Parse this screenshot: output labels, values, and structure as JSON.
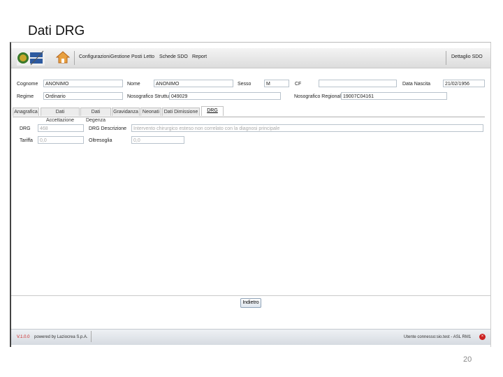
{
  "slide": {
    "title": "Dati DRG",
    "page_number": "20"
  },
  "app": {
    "logo_text": "REGIONE LAZIO",
    "menu": [
      "Configurazioni",
      "Gestione Posti Letto",
      "Schede SDO",
      "Report"
    ],
    "detail_label": "Dettaglio SDO"
  },
  "patient": {
    "cognome_label": "Cognome",
    "cognome_value": "ANONIMO",
    "nome_label": "Nome",
    "nome_value": "ANONIMO",
    "sesso_label": "Sesso",
    "sesso_value": "M",
    "cf_label": "CF",
    "cf_value": "",
    "data_nascita_label": "Data Nascita",
    "data_nascita_value": "21/02/1956",
    "regime_label": "Regime",
    "regime_value": "Ordinario",
    "nosografico_struttura_label": "Nosografico Struttura",
    "nosografico_struttura_value": "049029",
    "nosografico_regionale_label": "Nosografico Regionale",
    "nosografico_regionale_value": "19007C04161"
  },
  "tabs": [
    "Anagrafica",
    "Dati Accettazione",
    "Dati Degenza",
    "Gravidanza",
    "Neonati",
    "Dati Dimissione",
    "DRG"
  ],
  "drg": {
    "drg_label": "DRG",
    "drg_value": "468",
    "descrizione_label": "DRG Descrizione",
    "descrizione_value": "Intervento chirurgico esteso non correlato con la diagnosi principale",
    "tariffa_label": "Tariffa",
    "tariffa_value": "0,0",
    "oltresoglia_label": "Oltresoglia",
    "oltresoglia_value": "0,0"
  },
  "buttons": {
    "back": "Indietro"
  },
  "footer": {
    "version": "V.1.0.0",
    "powered": "powered by Laziocrea S.p.A.",
    "user": "Utente connesso:sio.test - ASL RM1"
  },
  "colors": {
    "version_red": "#cc2222",
    "header_bg": "#e6e6e6"
  }
}
